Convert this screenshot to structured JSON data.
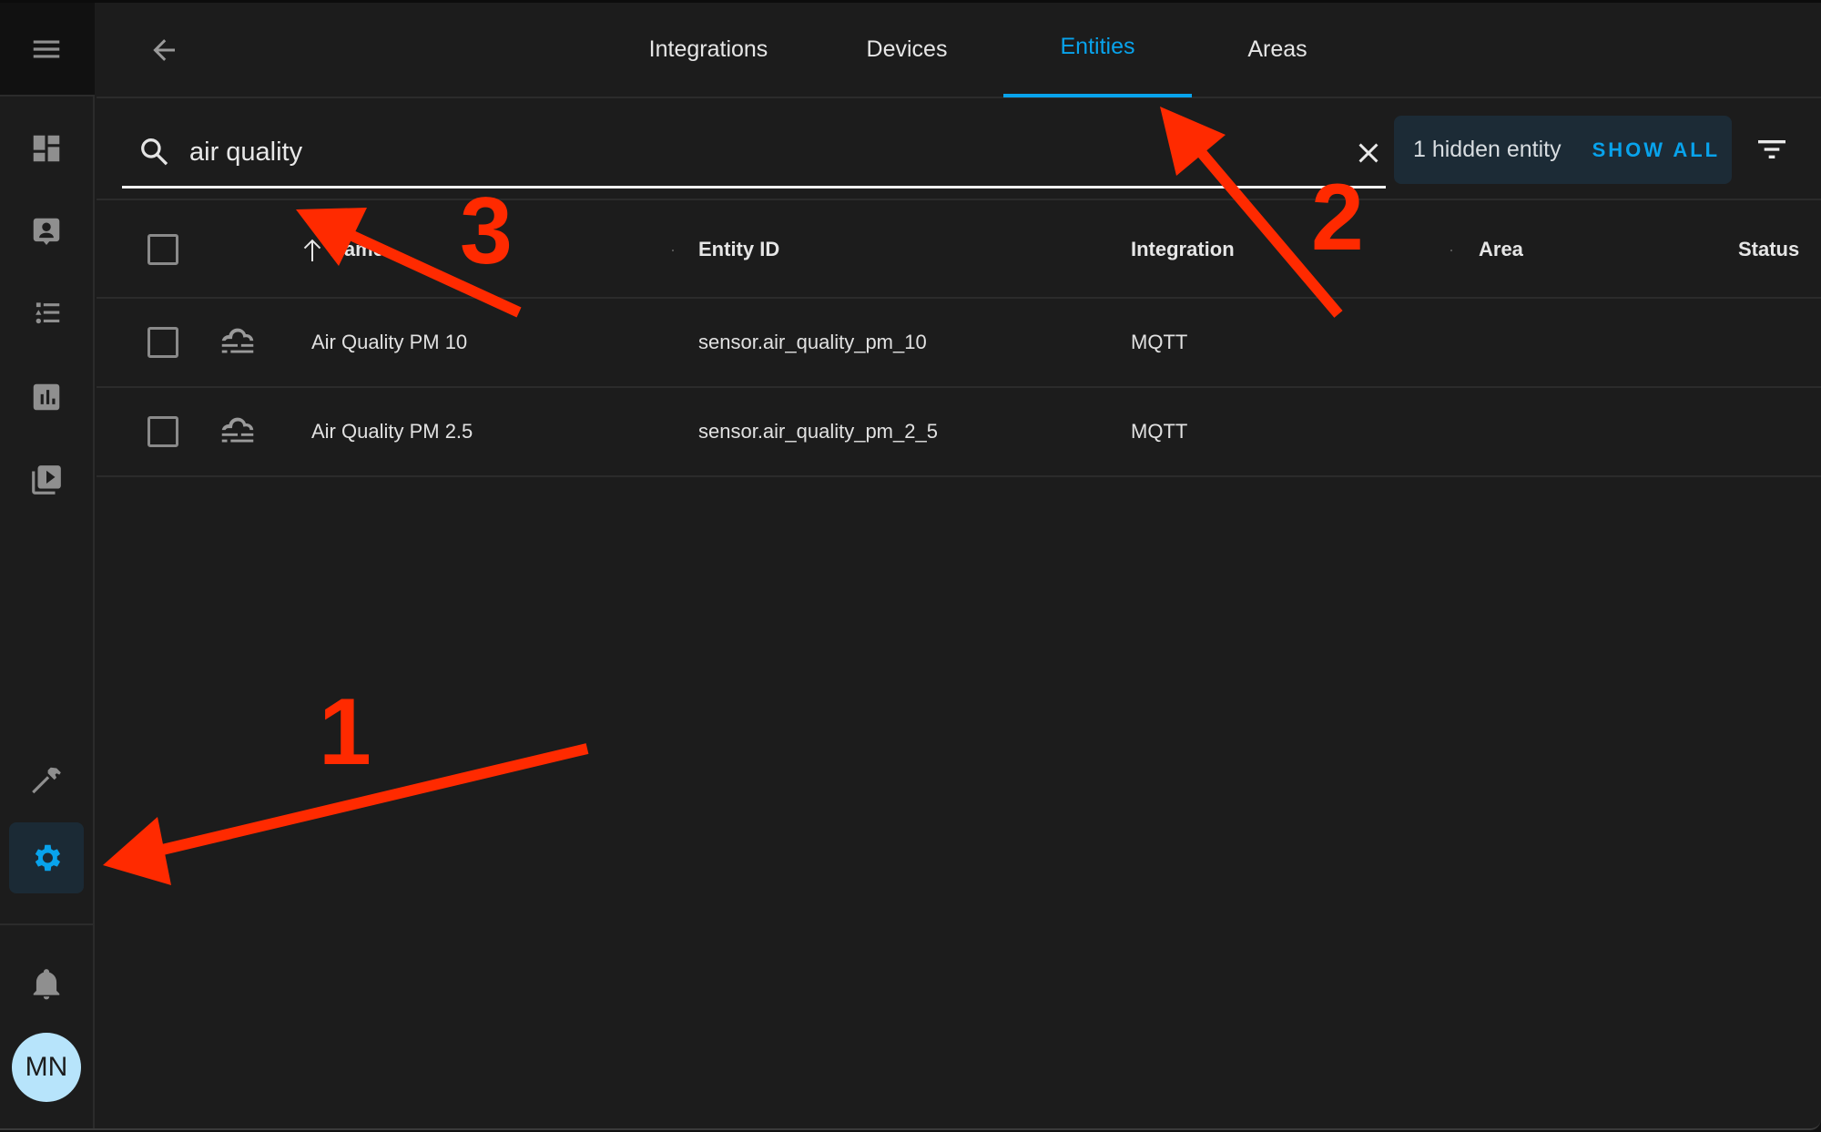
{
  "sidebar": {
    "menu_icon": "hamburger-menu-icon",
    "items": [
      {
        "name": "overview",
        "icon": "dashboard-icon",
        "active": false
      },
      {
        "name": "map-or-person",
        "icon": "account-box-icon",
        "active": false
      },
      {
        "name": "logbook",
        "icon": "format-list-bulleted-type-icon",
        "active": false
      },
      {
        "name": "history",
        "icon": "chart-box-icon",
        "active": false
      },
      {
        "name": "media",
        "icon": "play-box-multiple-icon",
        "active": false
      },
      {
        "name": "developer-tools",
        "icon": "hammer-icon",
        "active": false
      },
      {
        "name": "settings",
        "icon": "cog-icon",
        "active": true
      }
    ],
    "notifications_icon": "bell-icon",
    "user_initials": "MN"
  },
  "header": {
    "back_icon": "arrow-left-icon",
    "tabs": [
      {
        "label": "Integrations",
        "active": false
      },
      {
        "label": "Devices",
        "active": false
      },
      {
        "label": "Entities",
        "active": true
      },
      {
        "label": "Areas",
        "active": false
      }
    ]
  },
  "search": {
    "value": "air quality",
    "placeholder": "Search",
    "hidden_count_text": "1 hidden entity",
    "show_all_label": "SHOW ALL"
  },
  "table": {
    "columns": [
      "Name",
      "Entity ID",
      "Integration",
      "Area",
      "Status"
    ],
    "sort": {
      "column": "Name",
      "direction": "ascending"
    },
    "rows": [
      {
        "icon": "weather-hazy-icon",
        "name": "Air Quality PM 10",
        "entity_id": "sensor.air_quality_pm_10",
        "integration": "MQTT",
        "area": "",
        "status": ""
      },
      {
        "icon": "weather-hazy-icon",
        "name": "Air Quality PM 2.5",
        "entity_id": "sensor.air_quality_pm_2_5",
        "integration": "MQTT",
        "area": "",
        "status": ""
      }
    ]
  },
  "annotations": [
    {
      "label": "1",
      "points_to": "settings sidebar item"
    },
    {
      "label": "2",
      "points_to": "Entities tab"
    },
    {
      "label": "3",
      "points_to": "search field"
    }
  ],
  "colors": {
    "accent": "#08a3ec",
    "background": "#1c1c1c",
    "annotation": "#ff2a00",
    "chip_background": "#1c2b36",
    "avatar": "#b7e4fb"
  }
}
